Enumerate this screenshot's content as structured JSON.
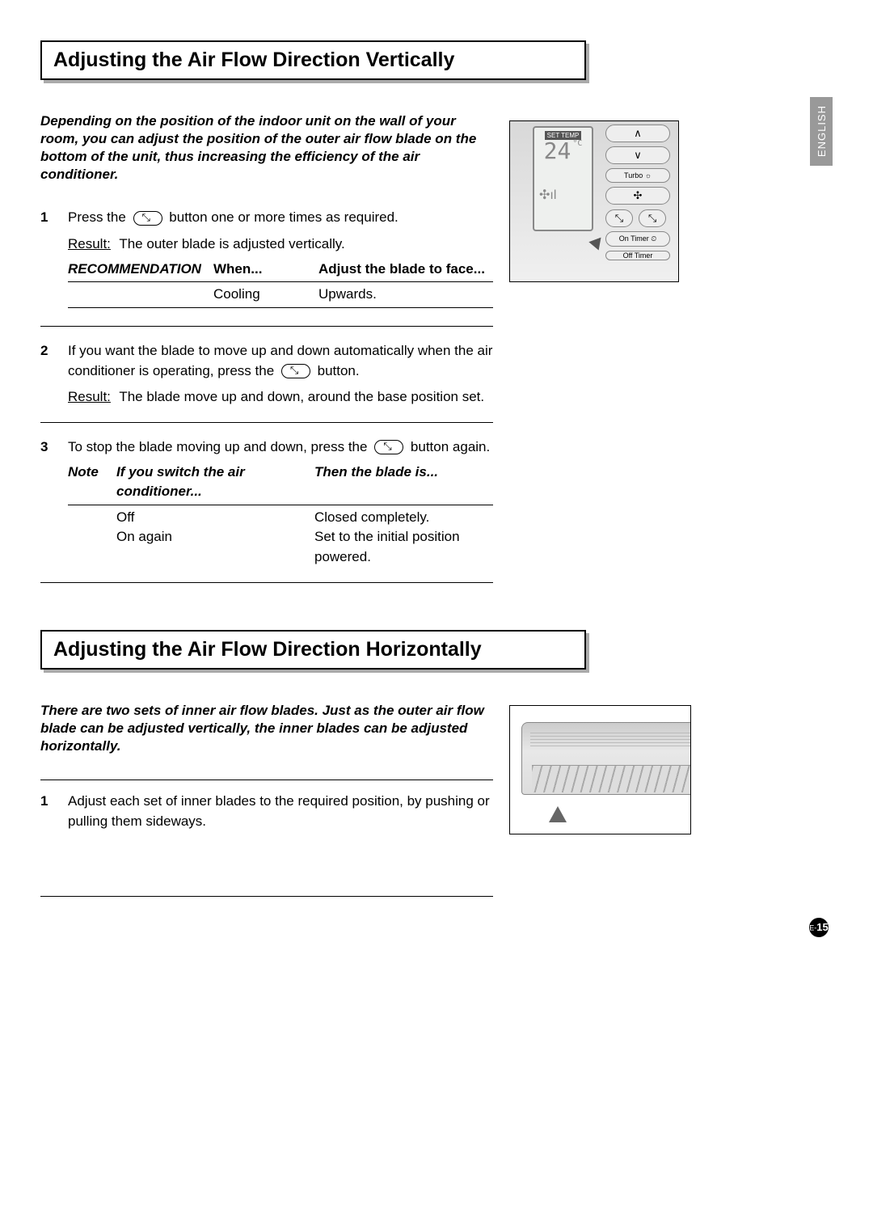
{
  "language_tab": "ENGLISH",
  "section1": {
    "title": "Adjusting the Air Flow Direction Vertically",
    "intro": "Depending on the position of the indoor unit on the wall of your room, you can adjust the position of the outer air flow blade on the bottom of the unit, thus increasing the efficiency of the air conditioner.",
    "step1": {
      "num": "1",
      "text_before_icon": "Press the ",
      "text_after_icon": " button one or more times as required.",
      "result_label": "Result:",
      "result_text": "The outer blade is adjusted vertically."
    },
    "rec": {
      "label": "RECOMMENDATION",
      "head_when": "When...",
      "head_adjust": "Adjust the blade to face...",
      "row_when": "Cooling",
      "row_adjust": "Upwards."
    },
    "step2": {
      "num": "2",
      "text_before_icon": "If you want the blade to move up and down automatically when the air conditioner is operating, press the ",
      "text_after_icon": " button.",
      "result_label": "Result:",
      "result_text": "The blade move up and down, around the base position set."
    },
    "step3": {
      "num": "3",
      "text_before_icon": "To stop the blade moving up and down, press the ",
      "text_after_icon": " button again."
    },
    "note": {
      "label": "Note",
      "head_if": "If you switch the air conditioner...",
      "head_then": "Then the blade is...",
      "row1_if": "Off",
      "row1_then": "Closed completely.",
      "row2_if": "On again",
      "row2_then": "Set to the initial position powered."
    },
    "remote": {
      "set_temp_label": "SET TEMP",
      "temp_value": "24",
      "deg_c": "°C",
      "turbo_label": "Turbo",
      "on_timer": "On Timer",
      "off_timer": "Off Timer"
    }
  },
  "section2": {
    "title": "Adjusting the Air Flow Direction Horizontally",
    "intro": "There are two sets of inner air flow blades. Just as the outer air flow blade can be adjusted vertically, the inner blades can be adjusted horizontally.",
    "step1": {
      "num": "1",
      "text": "Adjust each set of inner blades to the required position, by pushing or pulling them sideways."
    }
  },
  "page_number": {
    "prefix": "E-",
    "value": "15"
  }
}
